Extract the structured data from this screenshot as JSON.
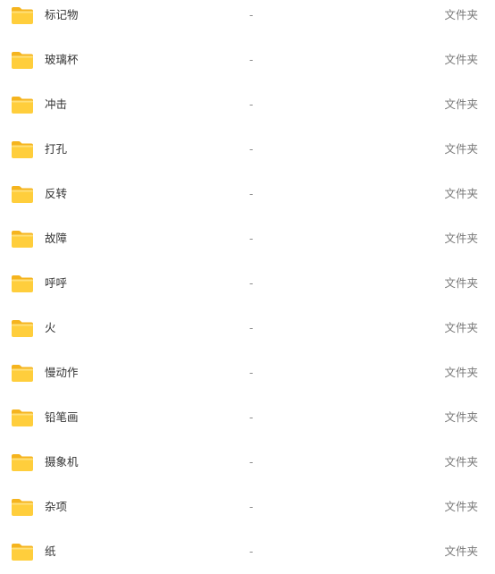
{
  "files": [
    {
      "name": "标记物",
      "size": "-",
      "type": "文件夹",
      "icon": "folder-icon"
    },
    {
      "name": "玻璃杯",
      "size": "-",
      "type": "文件夹",
      "icon": "folder-icon"
    },
    {
      "name": "冲击",
      "size": "-",
      "type": "文件夹",
      "icon": "folder-icon"
    },
    {
      "name": "打孔",
      "size": "-",
      "type": "文件夹",
      "icon": "folder-icon"
    },
    {
      "name": "反转",
      "size": "-",
      "type": "文件夹",
      "icon": "folder-icon"
    },
    {
      "name": "故障",
      "size": "-",
      "type": "文件夹",
      "icon": "folder-icon"
    },
    {
      "name": "呼呼",
      "size": "-",
      "type": "文件夹",
      "icon": "folder-icon"
    },
    {
      "name": "火",
      "size": "-",
      "type": "文件夹",
      "icon": "folder-icon"
    },
    {
      "name": "慢动作",
      "size": "-",
      "type": "文件夹",
      "icon": "folder-icon"
    },
    {
      "name": "铅笔画",
      "size": "-",
      "type": "文件夹",
      "icon": "folder-icon"
    },
    {
      "name": "摄象机",
      "size": "-",
      "type": "文件夹",
      "icon": "folder-icon"
    },
    {
      "name": "杂项",
      "size": "-",
      "type": "文件夹",
      "icon": "folder-icon"
    },
    {
      "name": "纸",
      "size": "-",
      "type": "文件夹",
      "icon": "folder-icon"
    }
  ],
  "colors": {
    "folder_body": "#FFCE3C",
    "folder_back": "#F5B41E",
    "folder_highlight": "#FFE07A",
    "name_text": "#333333",
    "meta_text": "#777777"
  }
}
